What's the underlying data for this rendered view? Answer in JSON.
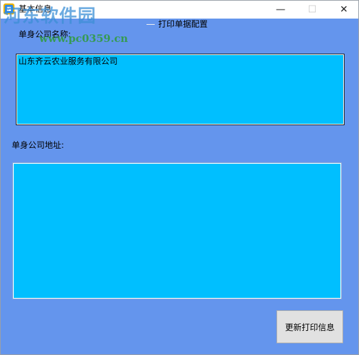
{
  "window": {
    "title": "基本信息",
    "minimize_glyph": "—",
    "maximize_glyph": "☐",
    "close_glyph": "✕"
  },
  "watermark": {
    "site_name": "河东软件园",
    "url": "www.pc0359.cn"
  },
  "form": {
    "section_title": "打印单据配置",
    "company_name_label": "单身公司名称:",
    "company_name_value": "山东齐云农业服务有限公司",
    "company_address_label": "单身公司地址:",
    "company_address_value": "",
    "update_button_label": "更新打印信息"
  },
  "colors": {
    "client_background": "#6495ed",
    "textbox_background": "#00bfff",
    "button_background": "#e1e1e1"
  }
}
